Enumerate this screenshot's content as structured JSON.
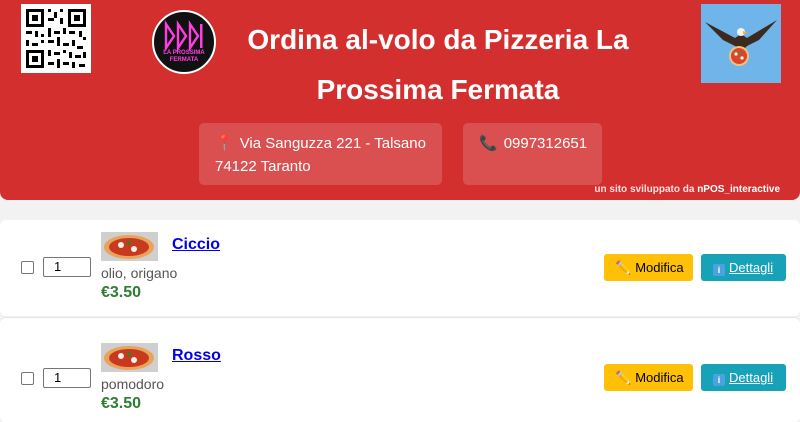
{
  "header": {
    "title": "Ordina al-volo da Pizzeria La Prossima Fermata",
    "logo_text": "LA PROSSIMA FERMATA",
    "address_line1": "Via Sanguzza 221 - Talsano",
    "address_line2": "74122 Taranto",
    "phone": "0997312651",
    "credit_prefix": "un sito sviluppato da",
    "credit_brand": "nPOS_interactive",
    "bg_color": "#d32f2f"
  },
  "products": [
    {
      "name": "Ciccio",
      "description": "olio, origano",
      "price": "€3.50",
      "quantity": "1"
    },
    {
      "name": "Rosso",
      "description": "pomodoro",
      "price": "€3.50",
      "quantity": "1"
    }
  ],
  "buttons": {
    "edit_label": "Modifica",
    "details_label": "Dettagli",
    "edit_color": "#ffc107",
    "details_color": "#17a2b8"
  },
  "icons": {
    "address": "pin-icon",
    "phone": "phone-icon",
    "edit": "pencil-icon",
    "details": "info-icon"
  }
}
